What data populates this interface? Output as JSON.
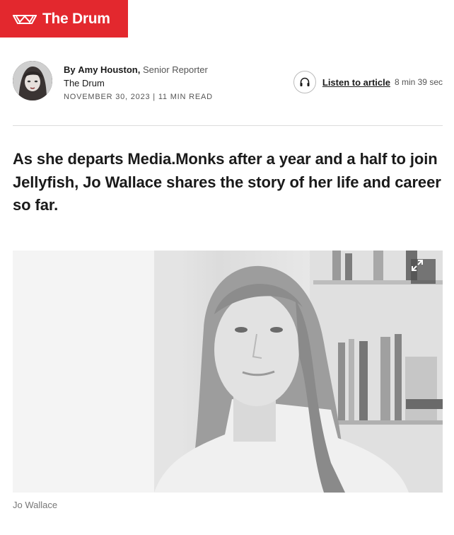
{
  "brand": {
    "name": "The Drum",
    "color": "#e3282e",
    "icon": "drum-crown-logo"
  },
  "byline": {
    "by_prefix": "By",
    "author": "Amy Houston,",
    "role": "Senior Reporter",
    "publication": "The Drum",
    "date": "November 30, 2023",
    "separator": "|",
    "read_time": "11 min read"
  },
  "listen": {
    "icon": "headphones-icon",
    "label": "Listen to article",
    "duration": "8 min 39 sec"
  },
  "article": {
    "standfirst": "As she departs Media.Monks after a year and a half to join Jellyfish, Jo Wallace shares the story of her life and career so far."
  },
  "hero": {
    "expand_icon": "expand-icon",
    "caption": "Jo Wallace"
  }
}
